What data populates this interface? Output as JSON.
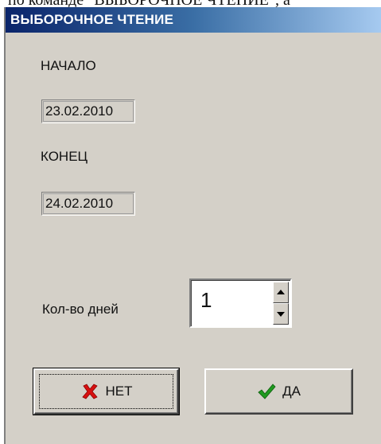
{
  "context_text": "по команде \"ВЫБОРОЧНОЕ ЧТЕНИЕ\", а",
  "window": {
    "title": "ВЫБОРОЧНОЕ ЧТЕНИЕ"
  },
  "form": {
    "start_label": "НАЧАЛО",
    "start_value": "23.02.2010",
    "end_label": "КОНЕЦ",
    "end_value": "24.02.2010",
    "days_label": "Кол-во дней",
    "days_value": "1"
  },
  "buttons": {
    "no_label": "НЕТ",
    "yes_label": "ДА"
  },
  "icons": {
    "no": "red-x-icon",
    "yes": "green-check-icon"
  },
  "colors": {
    "dialog_bg": "#d4d0c8",
    "title_bar_start": "#0a246a",
    "title_bar_end": "#a6caf0",
    "x_red": "#d81010",
    "check_green": "#1f9a1f"
  }
}
